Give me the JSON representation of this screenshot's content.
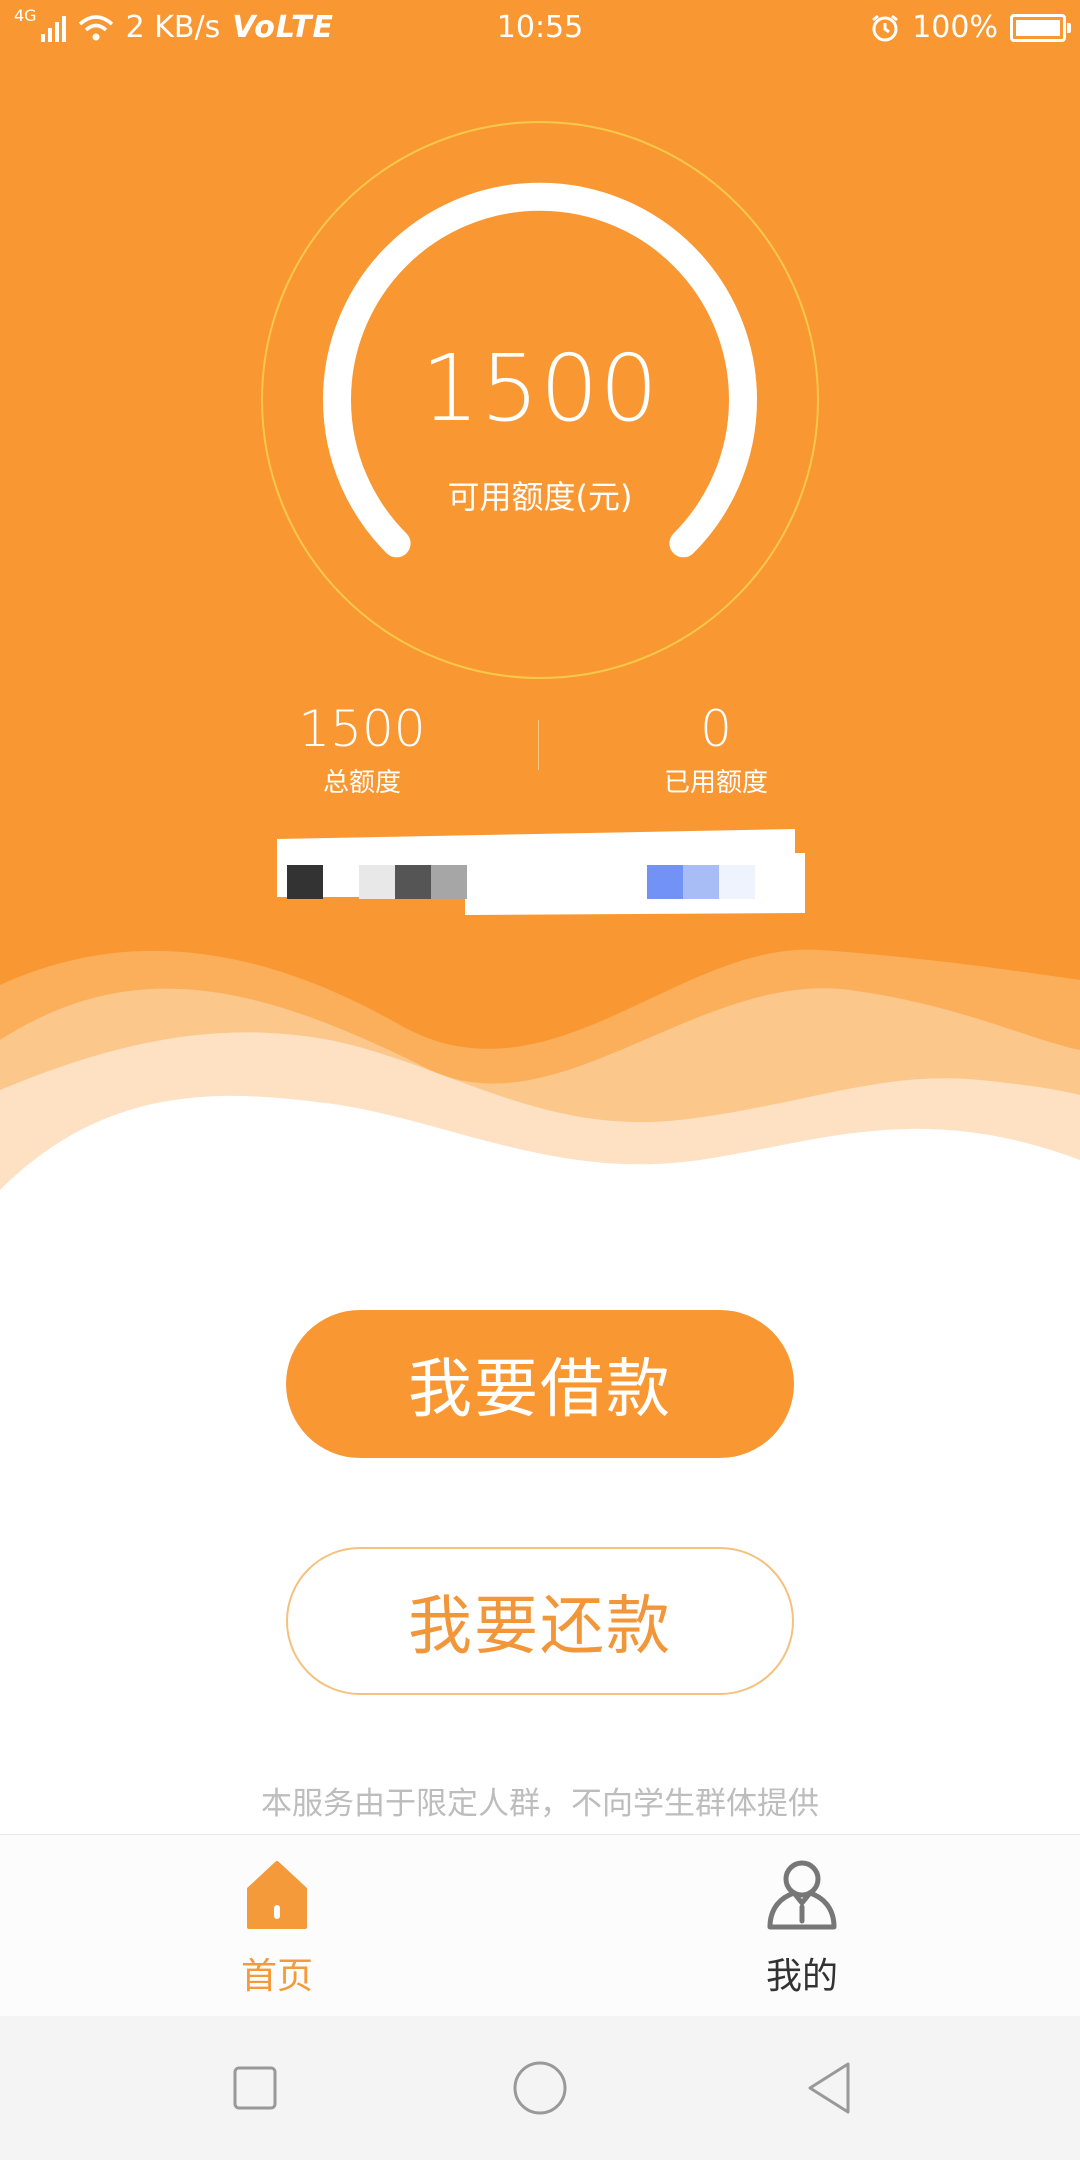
{
  "status_bar": {
    "network": "4G",
    "speed": "2 KB/s",
    "volte": "VoLTE",
    "time": "10:55",
    "battery": "100%"
  },
  "gauge": {
    "value": "1500",
    "label": "可用额度(元)"
  },
  "stats": {
    "total_value": "1500",
    "total_label": "总额度",
    "used_value": "0",
    "used_label": "已用额度"
  },
  "actions": {
    "borrow": "我要借款",
    "repay": "我要还款"
  },
  "notice": "本服务由于限定人群，不向学生群体提供",
  "tabbar": {
    "home": "首页",
    "mine": "我的"
  },
  "colors": {
    "accent": "#f99832",
    "background": "#ffffff"
  },
  "icons": {
    "home": "home-icon",
    "mine": "user-icon",
    "alarm": "alarm-icon",
    "wifi": "wifi-icon"
  }
}
